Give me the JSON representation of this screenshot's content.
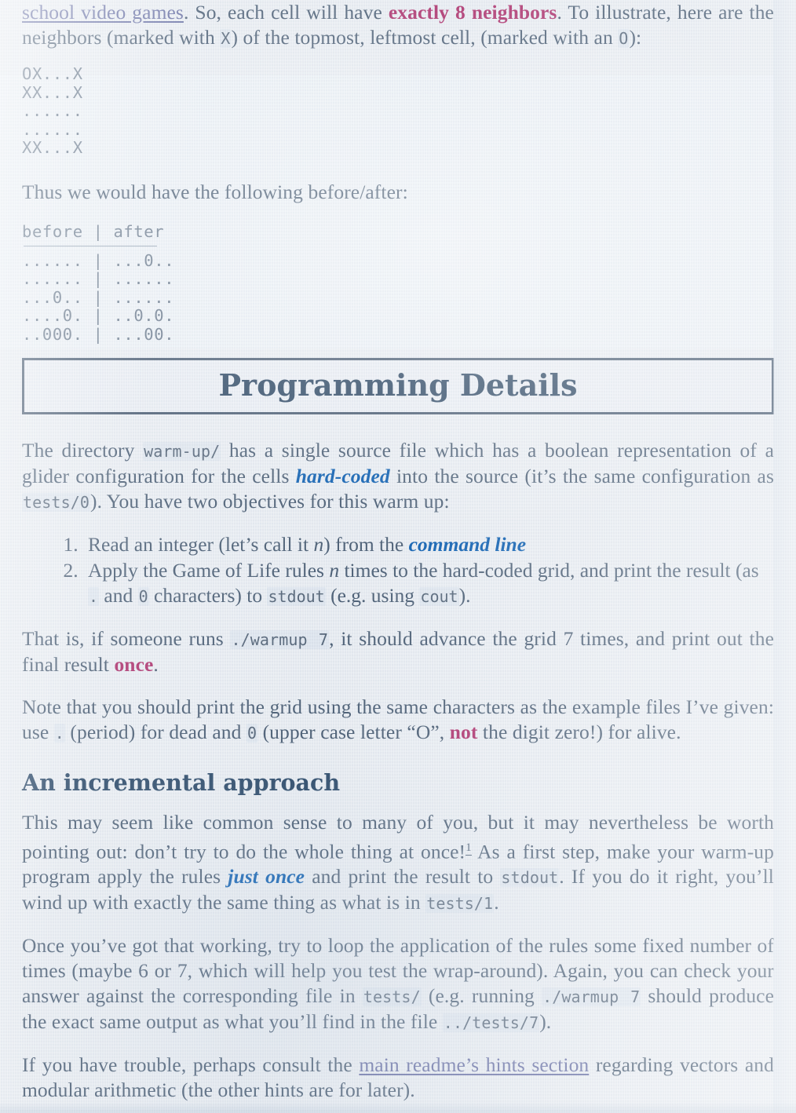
{
  "document": {
    "intro": {
      "link_text": "school video games",
      "after_link": ". So, each cell will have ",
      "emphasis": "exactly 8 neighbors",
      "tail_1": ". To illustrate, here are the neighbors (marked with ",
      "code_x": "X",
      "tail_2": ") of the topmost, leftmost cell, (marked with an ",
      "code_o": "O",
      "tail_3": "):"
    },
    "neighbor_grid": "OX...X\nXX...X\n......\n......\nXX...X",
    "before_after_intro": "Thus we would have the following before/after:",
    "before_after_table": {
      "header": "before | after",
      "rows": [
        "...... | ...0..",
        "...... | ......",
        "...0.. | ......",
        "....0. | ..0.0.",
        "..000. | ...00."
      ]
    },
    "section_title": "Programming Details",
    "directory_para": {
      "t1": "The directory ",
      "code_dir": "warm-up/",
      "t2": " has a single source file which has a boolean representation of a glider configuration for the cells ",
      "em": "hard-coded",
      "t3": " into the source (it’s the same configuration as ",
      "code_tests0": "tests/0",
      "t4": "). You have two objectives for this warm up:"
    },
    "objectives": [
      {
        "t1": "Read an integer (let’s call it ",
        "var": "n",
        "t2": ") from the ",
        "em": "command line",
        "t3": ""
      },
      {
        "t1": "Apply the Game of Life rules ",
        "var": "n",
        "t2": " times to the hard-coded grid, and print the result (as ",
        "code_dot": ".",
        "t3": " and ",
        "code_o": "0",
        "t4": " characters) to ",
        "code_stdout": "stdout",
        "t5": " (e.g. using ",
        "code_cout": "cout",
        "t6": ")."
      }
    ],
    "that_is_para": {
      "t1": "That is, if someone runs ",
      "code_cmd": "./warmup 7",
      "t2": ", it should advance the grid 7 times, and print out the final result ",
      "em": "once",
      "t3": "."
    },
    "note_para": {
      "t1": "Note that you should print the grid using the same characters as the example files I’ve given: use ",
      "code_dot": ".",
      "t2": " (period) for dead and ",
      "code_o": "0",
      "t3": " (upper case letter “O”, ",
      "em": "not",
      "t4": " the digit zero!) for alive."
    },
    "subsection_title": "An incremental approach",
    "incremental_para": {
      "t1": "This may seem like common sense to many of you, but it may nevertheless be worth pointing out: don’t try to do the whole thing at once!",
      "footnote": "1",
      "t2": " As a first step, make your warm-up program apply the rules ",
      "em": "just once",
      "t3": " and print the result to ",
      "code_stdout": "stdout",
      "t4": ". If you do it right, you’ll wind up with exactly the same thing as what is in ",
      "code_tests1": "tests/1",
      "t5": "."
    },
    "loop_para": {
      "t1": "Once you’ve got that working, try to loop the application of the rules some fixed number of times (maybe 6 or 7, which will help you test the wrap-around). Again, you can check your answer against the corresponding file in ",
      "code_tests": "tests/",
      "t2": " (e.g. running ",
      "code_cmd": "./warmup 7",
      "t3": " should produce the exact same output as what you’ll find in the file ",
      "code_path": "../tests/7",
      "t4": ")."
    },
    "trouble_para": {
      "t1": "If you have trouble, perhaps consult the ",
      "link_text": "main readme’s hints section",
      "t2": " regarding vectors and modular arithmetic (the other hints are for later)."
    }
  },
  "colors": {
    "body_text": "#51647a",
    "link": "#6c74a8",
    "emphasis_magenta": "#b33a74",
    "emphasis_blue": "#1565b5",
    "heading": "#2f4a66",
    "border": "#4e6076",
    "background": "#eef1f5"
  }
}
